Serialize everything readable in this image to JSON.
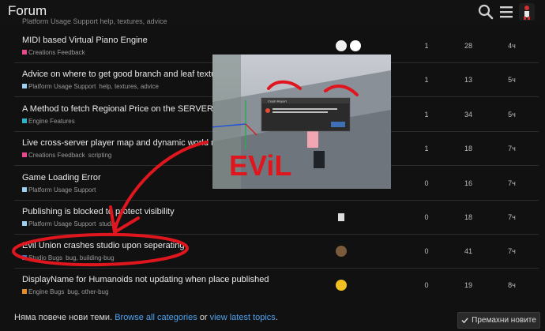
{
  "header": {
    "title": "Forum",
    "search_icon": "search-icon",
    "menu_icon": "hamburger-menu-icon",
    "avatar_icon": "user-avatar-icon"
  },
  "clipped_row_text": "Platform Usage Support  help, textures, advice",
  "topics": [
    {
      "title": "MIDI based Virtual Piano Engine",
      "category": "Creations Feedback",
      "category_color": "#e64a8c",
      "tags": "",
      "replies": "1",
      "views": "28",
      "activity": "4ч"
    },
    {
      "title": "Advice on where to get good branch and leaf textures",
      "category": "Platform Usage Support",
      "category_color": "#9bd0f0",
      "tags": "help, textures, advice",
      "replies": "1",
      "views": "13",
      "activity": "5ч"
    },
    {
      "title": "A Method to fetch Regional Price on the SERVER",
      "category": "Engine Features",
      "category_color": "#2db4c8",
      "tags": "",
      "replies": "1",
      "views": "34",
      "activity": "5ч"
    },
    {
      "title": "Live cross-server player map and dynamic world map",
      "category": "Creations Feedback",
      "category_color": "#e64a8c",
      "tags": "scripting",
      "replies": "1",
      "views": "18",
      "activity": "7ч"
    },
    {
      "title": "Game Loading Error",
      "category": "Platform Usage Support",
      "category_color": "#9bd0f0",
      "tags": "",
      "replies": "0",
      "views": "16",
      "activity": "7ч"
    },
    {
      "title": "Publishing is blocked to protect visibility",
      "category": "Platform Usage Support",
      "category_color": "#9bd0f0",
      "tags": "studio",
      "replies": "0",
      "views": "18",
      "activity": "7ч"
    },
    {
      "title": "Evil Union crashes studio upon seperating",
      "category": "Studio Bugs",
      "category_color": "#3c78c8",
      "tags": "bug, building-bug",
      "replies": "0",
      "views": "41",
      "activity": "7ч"
    },
    {
      "title": "DisplayName for Humanoids not updating when place published",
      "category": "Engine Bugs",
      "category_color": "#e68c28",
      "tags": "bug, other-bug",
      "replies": "0",
      "views": "19",
      "activity": "8ч"
    }
  ],
  "footer": {
    "prefix": "Няма повече нови теми.",
    "browse_link": "Browse all categories",
    "or": "or",
    "latest_link": "view latest topics",
    "period": "."
  },
  "dismiss_button": {
    "label": "Премахни новите",
    "icon": "check-icon"
  },
  "overlay_dialog": {
    "title": "Crash Report",
    "annotation_text": "EViL"
  },
  "annotation_color": "#e0161e"
}
